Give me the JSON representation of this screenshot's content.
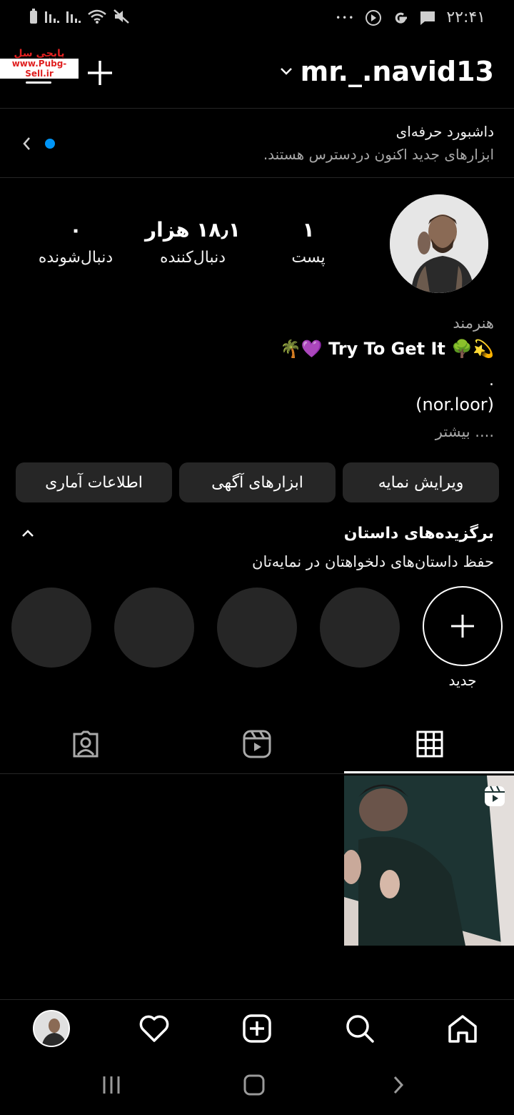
{
  "status_bar": {
    "time": "۲۲:۴۱",
    "more": "•••"
  },
  "watermark": {
    "line1": "پابجی سل",
    "line2": "www.Pubg-Sell.ir"
  },
  "header": {
    "username": "mr._.navid13"
  },
  "dashboard": {
    "title": "داشبورد حرفه‌ای",
    "subtitle": "ابزارهای جدید اکنون دردسترس هستند."
  },
  "stats": {
    "posts": {
      "value": "۱",
      "label": "پست"
    },
    "followers": {
      "value": "۱۸٫۱ هزار",
      "label": "دنبال‌کننده"
    },
    "following": {
      "value": "۰",
      "label": "دنبال‌شونده"
    }
  },
  "bio": {
    "category": "هنرمند",
    "line1": "🌴💜 Try To Get It 🌳💫",
    "dot": ".",
    "link": "(nor.loor)",
    "more": ".... بیشتر"
  },
  "buttons": {
    "edit_profile": "ویرایش نمایه",
    "ad_tools": "ابزارهای آگهی",
    "insights": "اطلاعات آماری"
  },
  "highlights": {
    "title": "برگزیده‌های داستان",
    "subtitle": "حفظ داستان‌های دلخواهتان در نمایه‌تان",
    "new_label": "جدید"
  },
  "colors": {
    "background": "#000000",
    "button_bg": "#262626",
    "accent_dot": "#0095f6",
    "secondary_text": "#a8a8a8"
  }
}
